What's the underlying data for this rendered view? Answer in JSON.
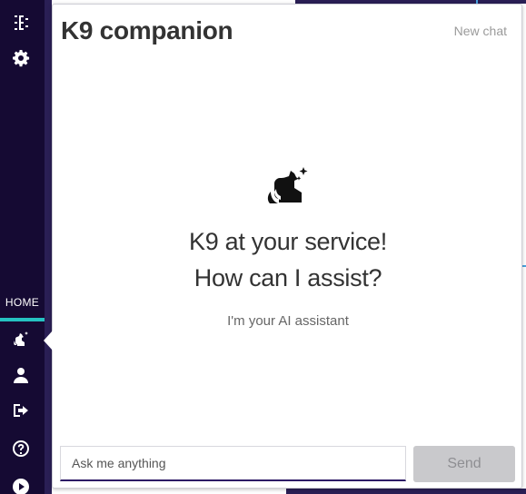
{
  "sidebar": {
    "home_label": "HOME",
    "items": [
      {
        "icon": "tree-icon"
      },
      {
        "icon": "gear-icon"
      },
      {
        "icon": "k9-icon",
        "active": true
      },
      {
        "icon": "user-icon"
      },
      {
        "icon": "logout-icon"
      },
      {
        "icon": "help-icon"
      },
      {
        "icon": "play-icon"
      }
    ],
    "accent_color": "#25c2c2",
    "background_color": "#150a33"
  },
  "chat": {
    "title": "K9 companion",
    "new_chat_label": "New chat",
    "hero_icon": "k9-dog-sparkle-icon",
    "headline_line1": "K9 at your service!",
    "headline_line2": "How can I assist?",
    "subtitle": "I'm your AI assistant",
    "input_placeholder": "Ask me anything",
    "input_value": "",
    "send_label": "Send"
  }
}
